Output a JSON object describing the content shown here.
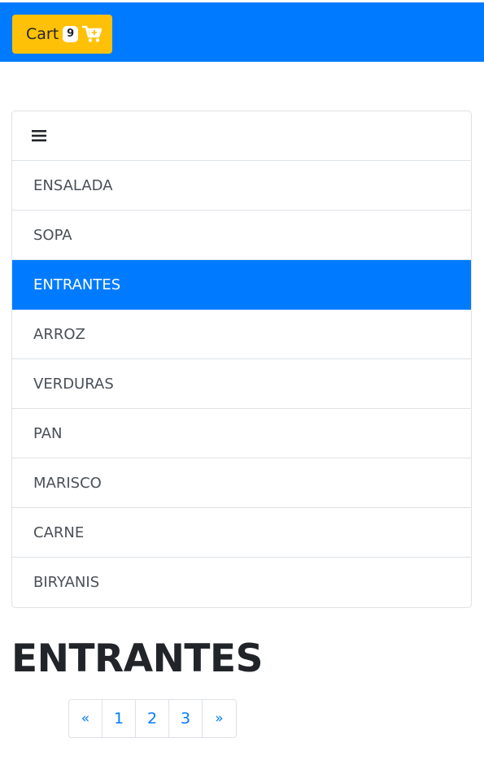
{
  "header": {
    "cart_label": "Cart",
    "cart_count": "9",
    "cart_icon": "shopping-cart-plus-icon",
    "bar_color": "#007bff",
    "cart_color": "#ffc107"
  },
  "menu": {
    "toggle_icon": "hamburger-icon",
    "items": [
      {
        "label": "ENSALADA",
        "active": false
      },
      {
        "label": "SOPA",
        "active": false
      },
      {
        "label": "ENTRANTES",
        "active": true
      },
      {
        "label": "ARROZ",
        "active": false
      },
      {
        "label": "VERDURAS",
        "active": false
      },
      {
        "label": "PAN",
        "active": false
      },
      {
        "label": "MARISCO",
        "active": false
      },
      {
        "label": "CARNE",
        "active": false
      },
      {
        "label": "BIRYANIS",
        "active": false
      }
    ]
  },
  "main": {
    "title": "ENTRANTES"
  },
  "pagination": {
    "prev": "«",
    "pages": [
      "1",
      "2",
      "3"
    ],
    "next": "»"
  }
}
